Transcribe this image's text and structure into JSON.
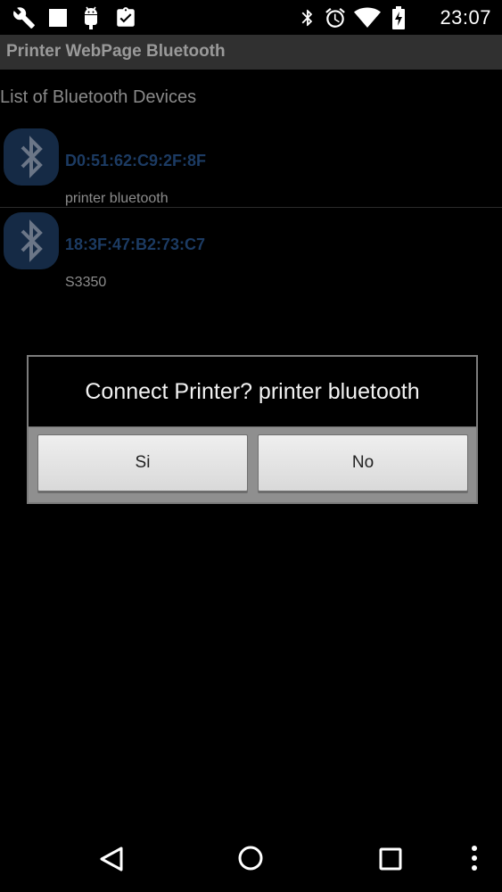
{
  "status_bar": {
    "time": "23:07",
    "left_icons": [
      "wrench-icon",
      "stop-square-icon",
      "android-debug-icon",
      "clipboard-check-icon"
    ],
    "right_icons": [
      "bluetooth-icon",
      "alarm-icon",
      "wifi-icon",
      "battery-icon"
    ]
  },
  "action_bar": {
    "title": "Printer WebPage Bluetooth"
  },
  "content": {
    "header": "List of Bluetooth Devices",
    "devices": [
      {
        "mac": "D0:51:62:C9:2F:8F",
        "name": "printer bluetooth",
        "icon": "bluetooth-icon"
      },
      {
        "mac": "18:3F:47:B2:73:C7",
        "name": "S3350",
        "icon": "bluetooth-icon"
      }
    ]
  },
  "dialog": {
    "message": "Connect Printer? printer bluetooth",
    "positive_label": "Si",
    "negative_label": "No"
  },
  "nav_bar": {
    "icons": [
      "back-icon",
      "home-icon",
      "recents-icon",
      "menu-icon"
    ]
  },
  "colors": {
    "background": "#000000",
    "action_bar": "#303030",
    "device_mac": "#1c3b63",
    "bluetooth_icon": "#1a3050"
  }
}
